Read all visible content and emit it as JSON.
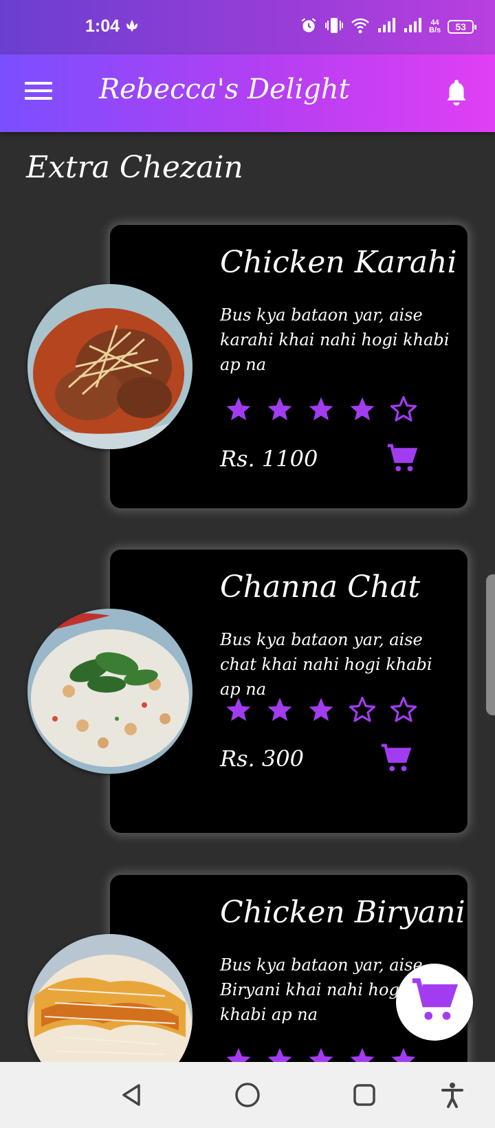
{
  "status_bar": {
    "time": "1:04",
    "net_speed_value": "44",
    "net_speed_unit": "B/s",
    "battery": "53"
  },
  "app_bar": {
    "title": "Rebecca's Delight"
  },
  "section": {
    "title": "Extra Chezain"
  },
  "dishes": [
    {
      "name": "Chicken Karahi",
      "description": "Bus kya bataon yar, aise karahi khai nahi hogi khabi ap na",
      "rating": 4,
      "max_rating": 5,
      "price": "Rs. 1100"
    },
    {
      "name": "Channa Chat",
      "description": "Bus kya bataon yar, aise chat khai nahi hogi khabi ap na",
      "rating": 3,
      "max_rating": 5,
      "price": "Rs. 300"
    },
    {
      "name": "Chicken Biryani",
      "description": "Bus kya bataon yar, aise Biryani khai nahi hogi khabi ap na",
      "rating": 5,
      "max_rating": 5,
      "price": ""
    }
  ],
  "colors": {
    "accent": "#a23cf0",
    "card_bg": "#000000",
    "page_bg": "#2e2e2e"
  },
  "icons": {
    "menu": "menu-icon",
    "bell": "bell-icon",
    "star": "star-icon",
    "cart": "cart-icon",
    "back": "back-triangle-icon",
    "home": "home-circle-icon",
    "recents": "recents-square-icon",
    "accessibility": "accessibility-icon"
  }
}
